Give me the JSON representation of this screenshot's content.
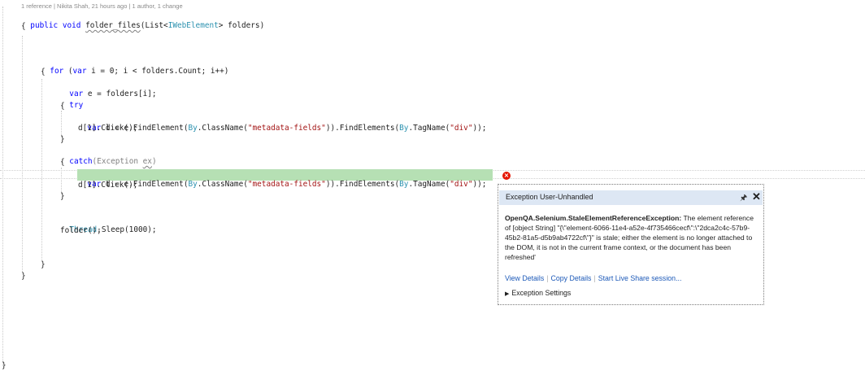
{
  "editor": {
    "codelens": "1 reference | Nikita Shah, 21 hours ago | 1 author, 1 change",
    "method": {
      "kw_public": "public",
      "kw_void": "void",
      "name": "folder_files",
      "paren_open": "(",
      "list_type": "List",
      "lt": "<",
      "elem_type": "IWebElement",
      "rest": "> folders)"
    },
    "brace_open": "{",
    "brace_close": "}",
    "for_kw": "for",
    "for_p1": " (",
    "for_var": "var",
    "for_rest": " i = 0; i < folders.Count; i++)",
    "var_kw": "var",
    "var_e_rest": " e = folders[i];",
    "try_kw": "try",
    "stmt1_var": "var",
    "stmt1_a": " d = e.FindElement(",
    "stmt1_by1": "By",
    "stmt1_b": ".ClassName(",
    "stmt1_str1": "\"metadata-fields\"",
    "stmt1_c": ")).FindElements(",
    "stmt1_by2": "By",
    "stmt1_d": ".TagName(",
    "stmt1_str2": "\"div\"",
    "stmt1_e": "));",
    "click_line": "d[1].Click();",
    "catch_kw": "catch",
    "catch_p": "(",
    "catch_type": "Exception",
    "catch_sp": " ",
    "catch_ex": "ex",
    "catch_close": ")",
    "thread_type": "Thread",
    "thread_rest": ".Sleep(1000);",
    "folder_call": "folder();"
  },
  "exception_popup": {
    "title": "Exception User-Unhandled",
    "pin_icon": "pin-icon",
    "close_icon": "close-icon",
    "exception_type": "OpenQA.Selenium.StaleElementReferenceException:",
    "message": "The element reference of [object String] \"{\\\"element-6066-11e4-a52e-4f735466cecf\\\":\\\"2dca2c4c-57b9-45b2-81a5-d5b9ab4722cf\\\"}\" is stale; either the element is no longer attached to the DOM, it is not in the current frame context, or the document has been refreshed'",
    "links": [
      "View Details",
      "Copy Details",
      "Start Live Share session..."
    ],
    "settings_label": "Exception Settings"
  },
  "colors": {
    "keyword": "#0000ff",
    "type": "#2b91af",
    "string": "#a31515",
    "current_statement": "#b6e0b4",
    "error_glyph": "#e51400",
    "popup_header": "#dde7f4",
    "link": "#1c59b8"
  }
}
